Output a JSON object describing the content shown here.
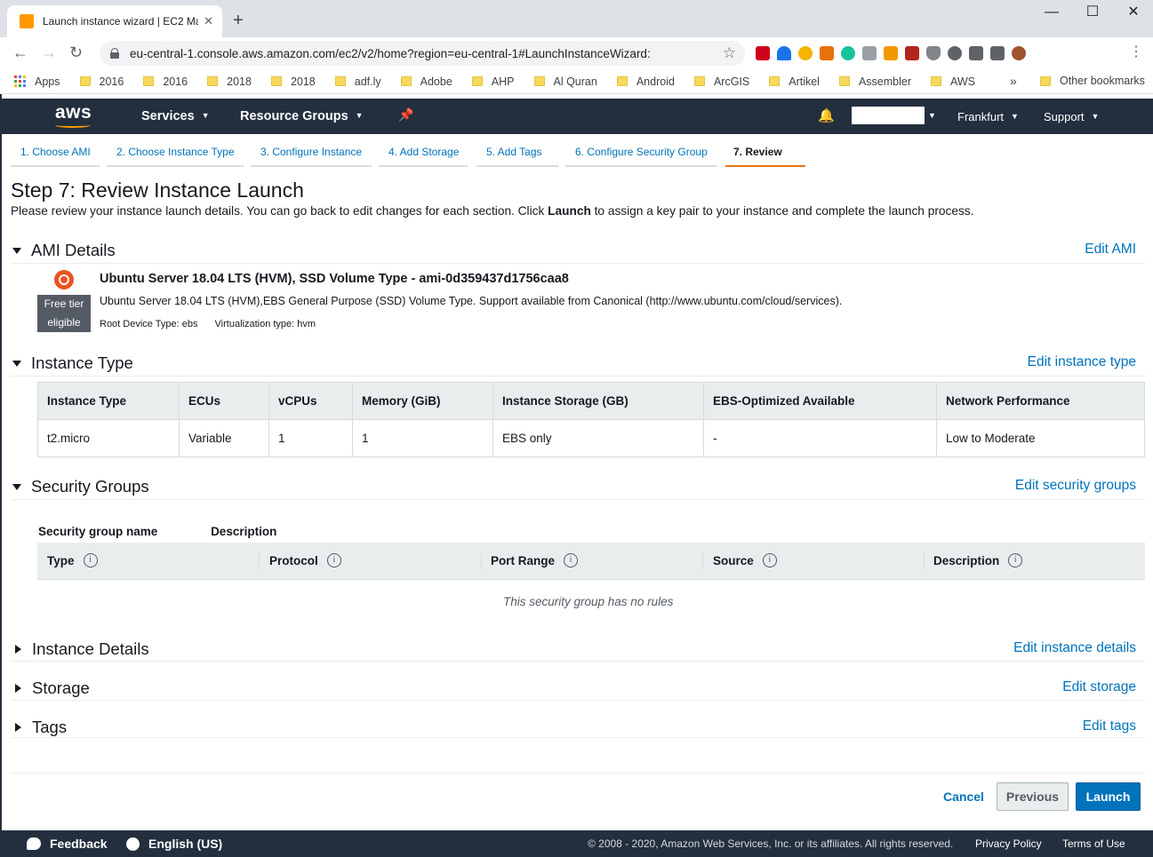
{
  "browser": {
    "tab_title": "Launch instance wizard | EC2 Ma",
    "url": "eu-central-1.console.aws.amazon.com/ec2/v2/home?region=eu-central-1#LaunchInstanceWizard:",
    "bookmarks": [
      "Apps",
      "2016",
      "2016",
      "2018",
      "2018",
      "adf.ly",
      "Adobe",
      "AHP",
      "Al Quran",
      "Android",
      "ArcGIS",
      "Artikel",
      "Assembler",
      "AWS"
    ],
    "other_bookmarks": "Other bookmarks",
    "more_bookmarks": "»",
    "new_tab_symbol": "+",
    "close_symbol": "✕",
    "minimize_symbol": "—",
    "maximize_symbol": "☐"
  },
  "aws_nav": {
    "logo": "aws",
    "services": "Services",
    "resource_groups": "Resource Groups",
    "region": "Frankfurt",
    "support": "Support"
  },
  "wizard": {
    "steps": [
      "1. Choose AMI",
      "2. Choose Instance Type",
      "3. Configure Instance",
      "4. Add Storage",
      "5. Add Tags",
      "6. Configure Security Group",
      "7. Review"
    ],
    "active_step": 7
  },
  "page": {
    "title": "Step 7: Review Instance Launch",
    "desc_before": "Please review your instance launch details. You can go back to edit changes for each section. Click ",
    "desc_bold": "Launch",
    "desc_after": " to assign a key pair to your instance and complete the launch process."
  },
  "ami": {
    "section_title": "AMI Details",
    "edit_link": "Edit AMI",
    "name": "Ubuntu Server 18.04 LTS (HVM), SSD Volume Type - ami-0d359437d1756caa8",
    "description": "Ubuntu Server 18.04 LTS (HVM),EBS General Purpose (SSD) Volume Type. Support available from Canonical (http://www.ubuntu.com/cloud/services).",
    "root_device": "Root Device Type: ebs",
    "virtualization": "Virtualization type: hvm",
    "badge_line1": "Free tier",
    "badge_line2": "eligible"
  },
  "instance_type": {
    "section_title": "Instance Type",
    "edit_link": "Edit instance type",
    "headers": [
      "Instance Type",
      "ECUs",
      "vCPUs",
      "Memory (GiB)",
      "Instance Storage (GB)",
      "EBS-Optimized Available",
      "Network Performance"
    ],
    "row": [
      "t2.micro",
      "Variable",
      "1",
      "1",
      "EBS only",
      "-",
      "Low to Moderate"
    ]
  },
  "security_groups": {
    "section_title": "Security Groups",
    "edit_link": "Edit security groups",
    "name_label": "Security group name",
    "desc_label": "Description",
    "columns": [
      "Type",
      "Protocol",
      "Port Range",
      "Source",
      "Description"
    ],
    "info_symbol": "i",
    "empty_text": "This security group has no rules"
  },
  "collapsed_sections": [
    {
      "title": "Instance Details",
      "edit_link": "Edit instance details"
    },
    {
      "title": "Storage",
      "edit_link": "Edit storage"
    },
    {
      "title": "Tags",
      "edit_link": "Edit tags"
    }
  ],
  "buttons": {
    "cancel": "Cancel",
    "previous": "Previous",
    "launch": "Launch"
  },
  "footer": {
    "feedback": "Feedback",
    "language": "English (US)",
    "copyright": "© 2008 - 2020, Amazon Web Services, Inc. or its affiliates. All rights reserved.",
    "privacy": "Privacy Policy",
    "terms": "Terms of Use"
  },
  "colors": {
    "aws_nav_bg": "#232f3e",
    "aws_orange": "#ff9900",
    "link_blue": "#0073bb",
    "active_tab_underline": "#ec7211"
  }
}
